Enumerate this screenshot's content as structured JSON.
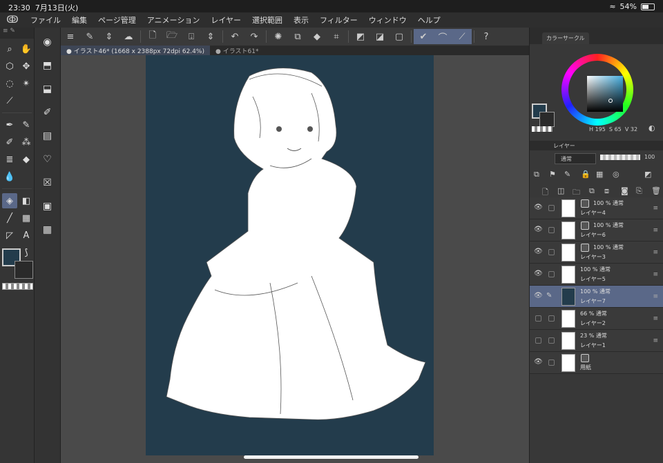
{
  "status": {
    "time": "23:30",
    "date": "7月13日(火)",
    "battery": "54%"
  },
  "menu": [
    "ファイル",
    "編集",
    "ページ管理",
    "アニメーション",
    "レイヤー",
    "選択範囲",
    "表示",
    "フィルター",
    "ウィンドウ",
    "ヘルプ"
  ],
  "tabs": [
    "イラスト46* (1668 x 2388px 72dpi 62.4%)",
    "イラスト61*"
  ],
  "colorpanel": {
    "title": "カラーサークル",
    "h": "195",
    "s": "65",
    "v": "32",
    "main_color": "#233c4c",
    "sub_color": "#2a2a2a"
  },
  "layerpanel": {
    "title": "レイヤー",
    "blend": "通常",
    "opacity": "100"
  },
  "layers": [
    {
      "pct": "100 %  通常",
      "name": "レイヤー4",
      "sublayer": true,
      "visible": true,
      "selected": false
    },
    {
      "pct": "100 %  通常",
      "name": "レイヤー6",
      "sublayer": true,
      "visible": true,
      "selected": false
    },
    {
      "pct": "100 %  通常",
      "name": "レイヤー3",
      "sublayer": true,
      "visible": true,
      "selected": false
    },
    {
      "pct": "100 %  通常",
      "name": "レイヤー5",
      "sublayer": false,
      "visible": true,
      "selected": false
    },
    {
      "pct": "100 %  通常",
      "name": "レイヤー7",
      "sublayer": false,
      "visible": true,
      "selected": true
    },
    {
      "pct": "66 %  通常",
      "name": "レイヤー2",
      "sublayer": false,
      "visible": false,
      "selected": false
    },
    {
      "pct": "23 %  通常",
      "name": "レイヤー1",
      "sublayer": false,
      "visible": false,
      "selected": false
    },
    {
      "pct": "",
      "name": "用紙",
      "sublayer": true,
      "visible": true,
      "selected": false
    }
  ]
}
